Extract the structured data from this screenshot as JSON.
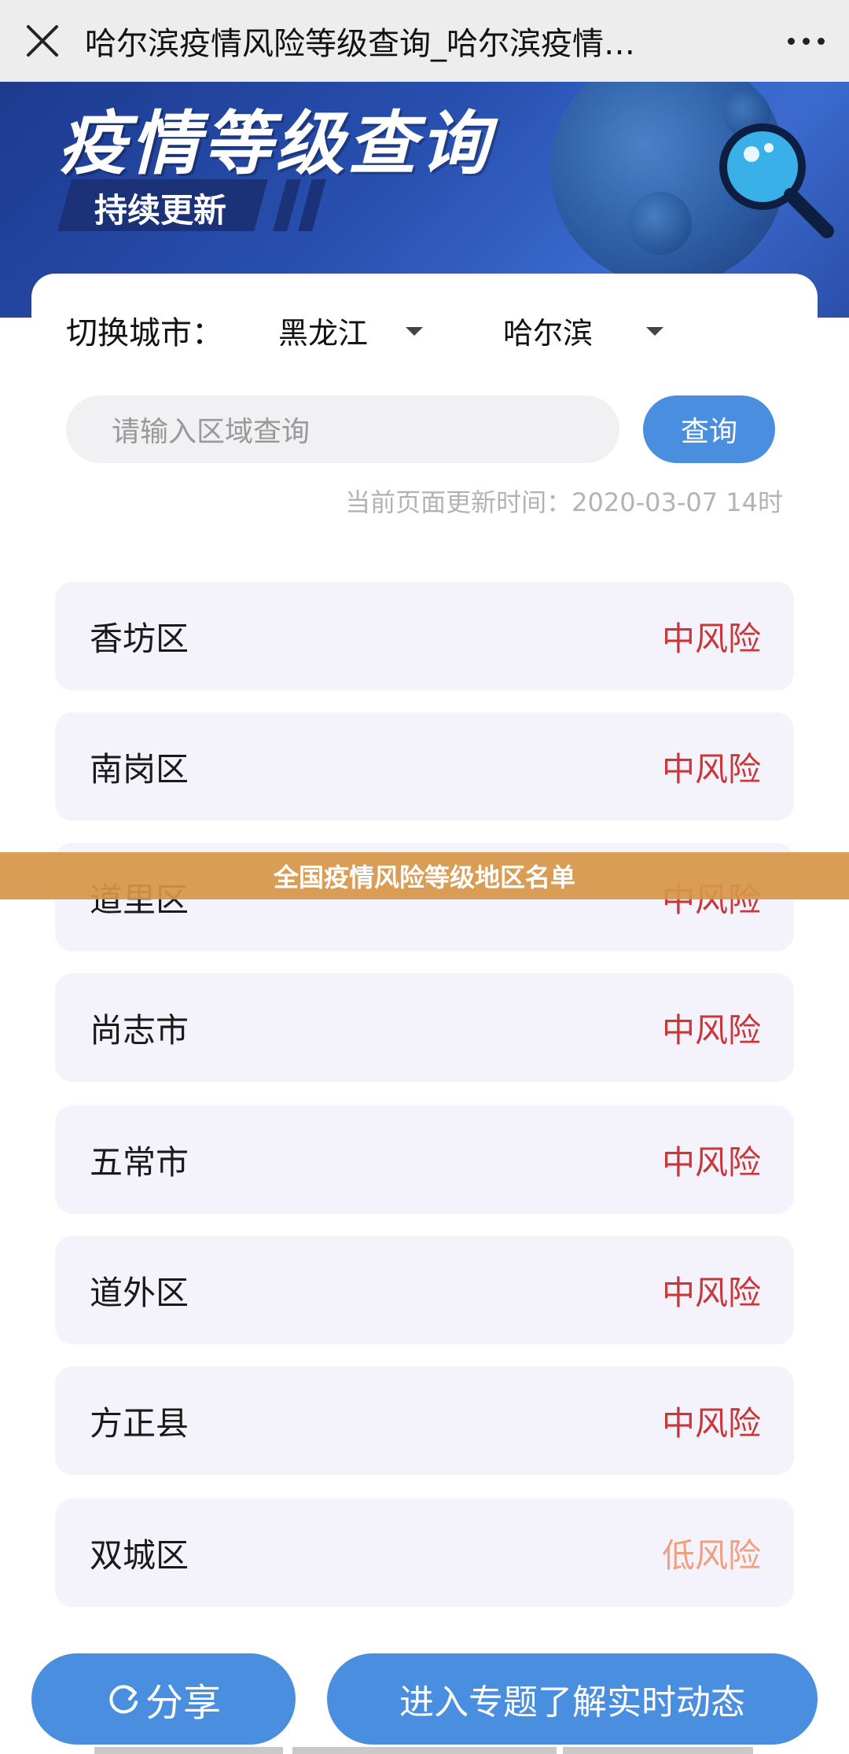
{
  "topbar": {
    "title": "哈尔滨疫情风险等级查询_哈尔滨疫情…"
  },
  "banner": {
    "title": "疫情等级查询",
    "tag": "持续更新"
  },
  "city_switch": {
    "label": "切换城市：",
    "province": "黑龙江",
    "city": "哈尔滨"
  },
  "search": {
    "placeholder": "请输入区域查询",
    "button_label": "查询"
  },
  "update_time": "当前页面更新时间：2020-03-07 14时",
  "districts": [
    {
      "name": "香坊区",
      "risk": "中风险"
    },
    {
      "name": "南岗区",
      "risk": "中风险"
    },
    {
      "name": "道里区",
      "risk": "中风险"
    },
    {
      "name": "尚志市",
      "risk": "中风险"
    },
    {
      "name": "五常市",
      "risk": "中风险"
    },
    {
      "name": "道外区",
      "risk": "中风险"
    },
    {
      "name": "方正县",
      "risk": "中风险"
    },
    {
      "name": "双城区",
      "risk": "低风险"
    }
  ],
  "colors": {
    "medium_risk": "#c8373a",
    "low_risk": "#f0a07e",
    "accent": "#4a8ee0"
  },
  "caption": "全国疫情风险等级地区名单",
  "actions": {
    "share_label": "分享",
    "topic_label": "进入专题了解实时动态"
  }
}
